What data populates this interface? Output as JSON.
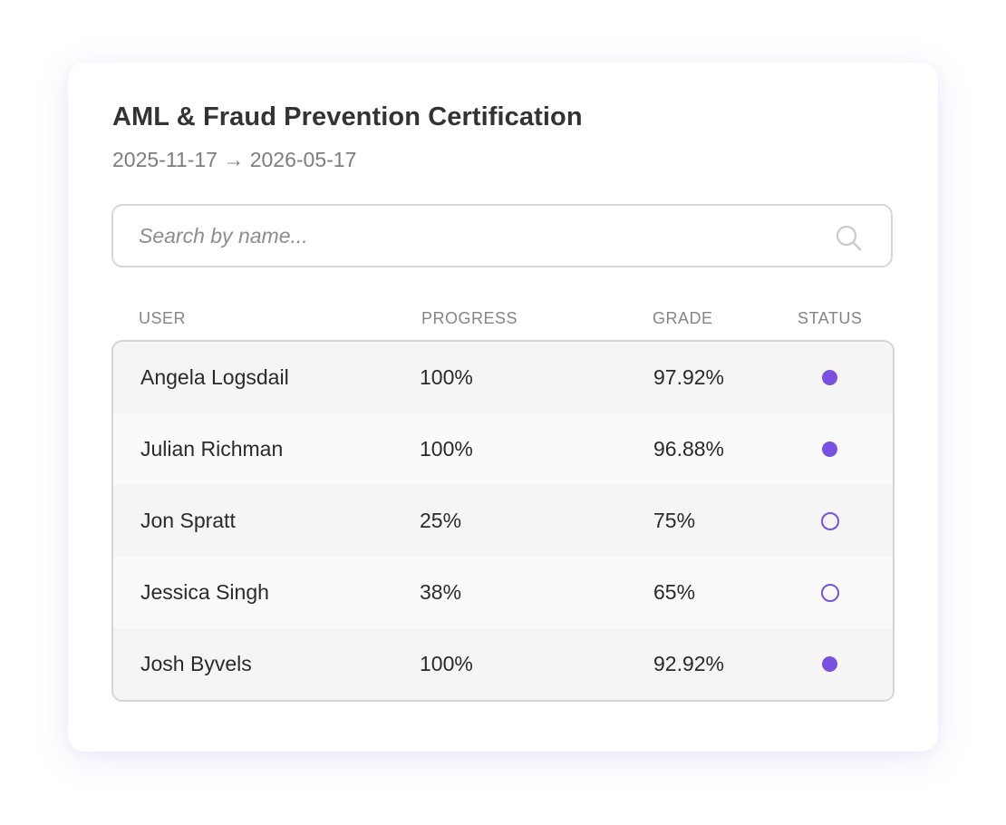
{
  "card": {
    "title": "AML & Fraud Prevention Certification",
    "date_range": "2025-11-17 → 2026-05-17"
  },
  "search": {
    "placeholder": "Search by name...",
    "value": "",
    "icon": "search-icon"
  },
  "table": {
    "columns": [
      "USER",
      "PROGRESS",
      "GRADE",
      "STATUS"
    ],
    "rows": [
      {
        "user": "Angela Logsdail",
        "progress": "100%",
        "grade": "97.92%",
        "status": "complete"
      },
      {
        "user": "Julian Richman",
        "progress": "100%",
        "grade": "96.88%",
        "status": "complete"
      },
      {
        "user": "Jon Spratt",
        "progress": "25%",
        "grade": "75%",
        "status": "incomplete"
      },
      {
        "user": "Jessica Singh",
        "progress": "38%",
        "grade": "65%",
        "status": "incomplete"
      },
      {
        "user": "Josh Byvels",
        "progress": "100%",
        "grade": "92.92%",
        "status": "complete"
      }
    ]
  },
  "colors": {
    "accent": "#7a50e0",
    "title_text": "#333333",
    "muted_text": "#7d7d7d",
    "border": "#d3d3da"
  }
}
